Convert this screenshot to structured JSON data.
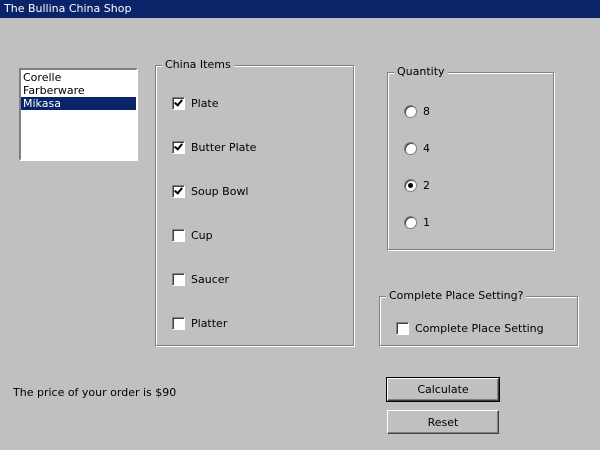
{
  "window": {
    "title": "The Bullina China Shop"
  },
  "brands": {
    "items": [
      "Corelle",
      "Farberware",
      "Mikasa"
    ],
    "selected": "Mikasa"
  },
  "china_items": {
    "title": "China Items",
    "items": [
      {
        "label": "Plate",
        "checked": true
      },
      {
        "label": "Butter Plate",
        "checked": true
      },
      {
        "label": "Soup Bowl",
        "checked": true
      },
      {
        "label": "Cup",
        "checked": false
      },
      {
        "label": "Saucer",
        "checked": false
      },
      {
        "label": "Platter",
        "checked": false
      }
    ]
  },
  "quantity": {
    "title": "Quantity",
    "options": [
      "8",
      "4",
      "2",
      "1"
    ],
    "selected": "2"
  },
  "place_setting": {
    "title": "Complete  Place Setting?",
    "checkbox_label": "Complete  Place Setting",
    "checked": false
  },
  "order": {
    "price_text": "The price of your  order is $90"
  },
  "buttons": {
    "calculate": "Calculate",
    "reset": "Reset"
  },
  "colors": {
    "titlebar": "#0a246a",
    "face": "#c0c0c0",
    "selection": "#0a246a"
  }
}
